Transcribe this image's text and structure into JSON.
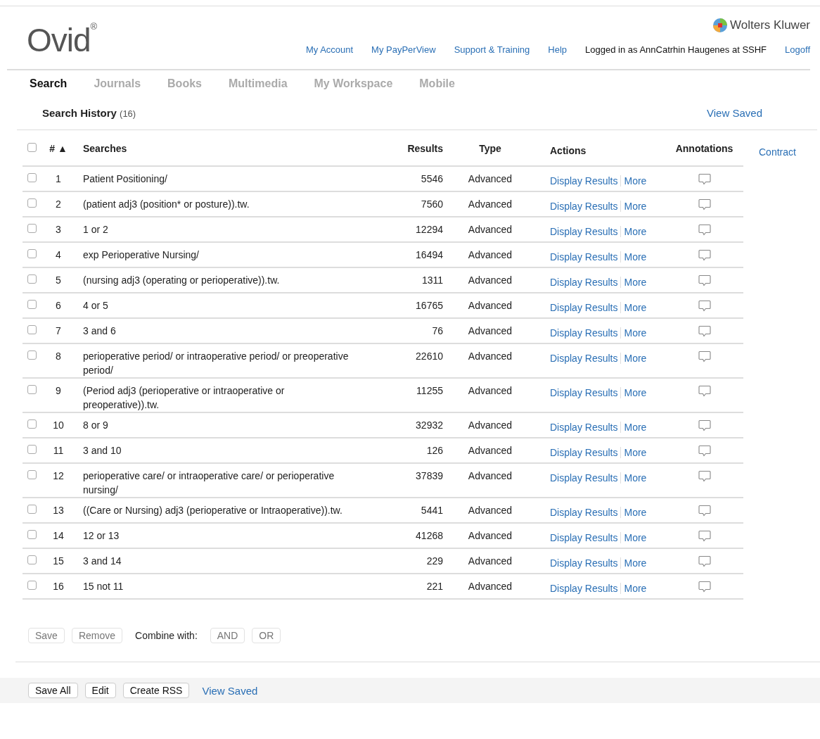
{
  "header": {
    "logo": "Ovid",
    "logo_mark": "®",
    "brand": "Wolters Kluwer",
    "links": [
      "My Account",
      "My PayPerView",
      "Support & Training",
      "Help"
    ],
    "login_text": "Logged in as AnnCatrhin Haugenes at SSHF",
    "logoff": "Logoff"
  },
  "tabs": [
    {
      "label": "Search",
      "selected": true
    },
    {
      "label": "Journals",
      "selected": false
    },
    {
      "label": "Books",
      "selected": false
    },
    {
      "label": "Multimedia",
      "selected": false
    },
    {
      "label": "My Workspace",
      "selected": false
    },
    {
      "label": "Mobile",
      "selected": false
    }
  ],
  "history": {
    "title": "Search History",
    "count": "(16)",
    "view_saved": "View Saved",
    "contract": "Contract"
  },
  "table": {
    "all_checked": false,
    "columns": [
      "#",
      "▲",
      "Searches",
      "Results",
      "Type",
      "Actions",
      "Annotations"
    ],
    "rows": [
      {
        "num": "1",
        "search": "Patient Positioning/",
        "results": "5546",
        "type": "Advanced",
        "actions": [
          "Display Results",
          "More"
        ],
        "checked": false
      },
      {
        "num": "2",
        "search": "(patient adj3 (position* or posture)).tw.",
        "results": "7560",
        "type": "Advanced",
        "actions": [
          "Display Results",
          "More"
        ],
        "checked": false
      },
      {
        "num": "3",
        "search": "1 or 2",
        "results": "12294",
        "type": "Advanced",
        "actions": [
          "Display Results",
          "More"
        ],
        "checked": false
      },
      {
        "num": "4",
        "search": "exp Perioperative Nursing/",
        "results": "16494",
        "type": "Advanced",
        "actions": [
          "Display Results",
          "More"
        ],
        "checked": false
      },
      {
        "num": "5",
        "search": "(nursing adj3 (operating or perioperative)).tw.",
        "results": "1311",
        "type": "Advanced",
        "actions": [
          "Display Results",
          "More"
        ],
        "checked": false
      },
      {
        "num": "6",
        "search": "4 or 5",
        "results": "16765",
        "type": "Advanced",
        "actions": [
          "Display Results",
          "More"
        ],
        "checked": false
      },
      {
        "num": "7",
        "search": "3 and 6",
        "results": "76",
        "type": "Advanced",
        "actions": [
          "Display Results",
          "More"
        ],
        "checked": false
      },
      {
        "num": "8",
        "search": "perioperative period/ or intraoperative period/ or preoperative period/",
        "results": "22610",
        "type": "Advanced",
        "actions": [
          "Display Results",
          "More"
        ],
        "checked": false
      },
      {
        "num": "9",
        "search": "(Period adj3 (perioperative or intraoperative or preoperative)).tw.",
        "results": "11255",
        "type": "Advanced",
        "actions": [
          "Display Results",
          "More"
        ],
        "checked": false
      },
      {
        "num": "10",
        "search": "8 or 9",
        "results": "32932",
        "type": "Advanced",
        "actions": [
          "Display Results",
          "More"
        ],
        "checked": false
      },
      {
        "num": "11",
        "search": "3 and 10",
        "results": "126",
        "type": "Advanced",
        "actions": [
          "Display Results",
          "More"
        ],
        "checked": false
      },
      {
        "num": "12",
        "search": "perioperative care/ or intraoperative care/ or perioperative nursing/",
        "results": "37839",
        "type": "Advanced",
        "actions": [
          "Display Results",
          "More"
        ],
        "checked": false
      },
      {
        "num": "13",
        "search": "((Care or Nursing) adj3 (perioperative or Intraoperative)).tw.",
        "results": "5441",
        "type": "Advanced",
        "actions": [
          "Display Results",
          "More"
        ],
        "checked": false
      },
      {
        "num": "14",
        "search": "12 or 13",
        "results": "41268",
        "type": "Advanced",
        "actions": [
          "Display Results",
          "More"
        ],
        "checked": false
      },
      {
        "num": "15",
        "search": "3 and 14",
        "results": "229",
        "type": "Advanced",
        "actions": [
          "Display Results",
          "More"
        ],
        "checked": false
      },
      {
        "num": "16",
        "search": "15 not 11",
        "results": "221",
        "type": "Advanced",
        "actions": [
          "Display Results",
          "More"
        ],
        "checked": false
      }
    ]
  },
  "selection_actions": {
    "buttons": [
      {
        "label": "Save",
        "disabled": true
      },
      {
        "label": "Remove",
        "disabled": true
      }
    ],
    "combine_label": "Combine with:",
    "combine_buttons": [
      {
        "label": "AND",
        "disabled": true
      },
      {
        "label": "OR",
        "disabled": true
      }
    ]
  },
  "footer": {
    "buttons": [
      "Save All",
      "Edit",
      "Create RSS"
    ],
    "view_saved": "View Saved"
  }
}
